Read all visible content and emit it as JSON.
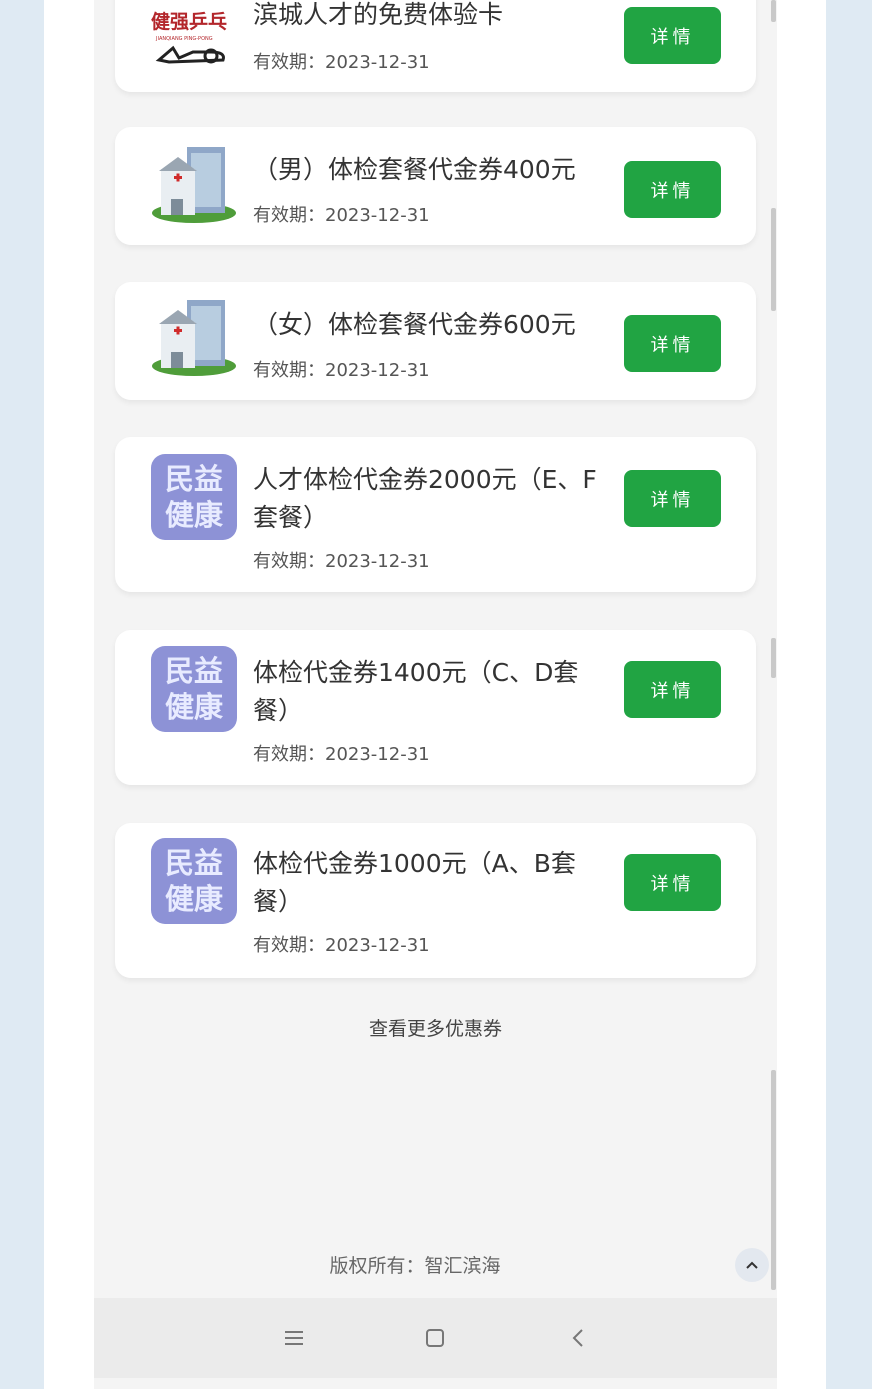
{
  "coupons": [
    {
      "title": "滨城人才的免费体验卡",
      "validity": "有效期：2023-12-31",
      "button": "详情",
      "icon": "pingpong-logo",
      "logo_text": "健强乒乓",
      "logo_sub": "JIANQIANG PING-PONG"
    },
    {
      "title": "（男）体检套餐代金券400元",
      "validity": "有效期：2023-12-31",
      "button": "详情",
      "icon": "hospital-icon"
    },
    {
      "title": "（女）体检套餐代金券600元",
      "validity": "有效期：2023-12-31",
      "button": "详情",
      "icon": "hospital-icon"
    },
    {
      "title": "人才体检代金券2000元（E、F套餐）",
      "validity": "有效期：2023-12-31",
      "button": "详情",
      "icon": "minyi-logo",
      "logo_line1": "民益",
      "logo_line2": "健康"
    },
    {
      "title": "体检代金券1400元（C、D套餐）",
      "validity": "有效期：2023-12-31",
      "button": "详情",
      "icon": "minyi-logo",
      "logo_line1": "民益",
      "logo_line2": "健康"
    },
    {
      "title": "体检代金券1000元（A、B套餐）",
      "validity": "有效期：2023-12-31",
      "button": "详情",
      "icon": "minyi-logo",
      "logo_line1": "民益",
      "logo_line2": "健康"
    }
  ],
  "more_link": "查看更多优惠券",
  "footer": {
    "copyright": "版权所有：智汇滨海"
  },
  "colors": {
    "button_green": "#21a443",
    "logo_purple": "#8d92d6"
  }
}
